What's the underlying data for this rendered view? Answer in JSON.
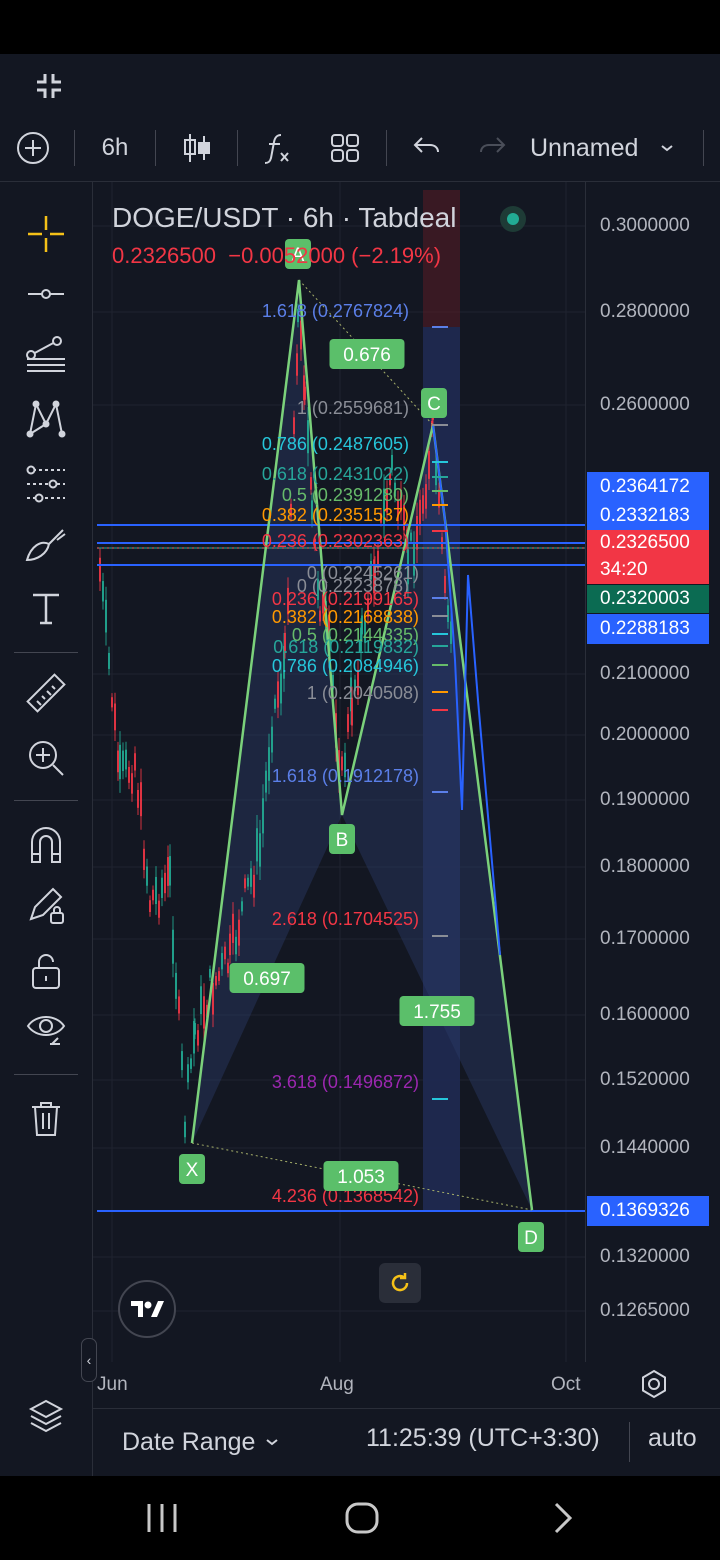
{
  "toolbar": {
    "interval": "6h",
    "layout_name": "Unnamed"
  },
  "legend": {
    "symbol": "DOGE/USDT · 6h · Tabdeal",
    "quote": "0.2326500  −0.0052000 (−2.19%)"
  },
  "price_axis": {
    "ticks": [
      "0.3000000",
      "0.2800000",
      "0.2600000",
      "0.2100000",
      "0.2000000",
      "0.1900000",
      "0.1800000",
      "0.1700000",
      "0.1600000",
      "0.1520000",
      "0.1440000",
      "0.1320000",
      "0.1265000"
    ],
    "badges": [
      {
        "text": "0.2364172",
        "color": "#2962ff"
      },
      {
        "text": "0.2332183",
        "color": "#2962ff"
      },
      {
        "text": "0.2326500",
        "color": "#f23645"
      },
      {
        "text": "34:20",
        "color": "#f23645"
      },
      {
        "text": "0.2320003",
        "color": "#0b6b52"
      },
      {
        "text": "0.2288183",
        "color": "#2962ff"
      },
      {
        "text": "0.1369326",
        "color": "#2962ff"
      }
    ]
  },
  "time_axis": {
    "labels": [
      "Jun",
      "Aug",
      "Oct"
    ]
  },
  "pattern": {
    "points": [
      "X",
      "A",
      "B",
      "C",
      "D"
    ],
    "ratios": [
      "0.676",
      "0.697",
      "1.755",
      "1.053"
    ]
  },
  "fib_upper": [
    {
      "text": "1.618 (0.2767824)",
      "color": "#5b7fe8"
    },
    {
      "text": "1 (0.2559681)",
      "color": "#8a8d96"
    },
    {
      "text": "0.786 (0.2487605)",
      "color": "#26c6da"
    },
    {
      "text": "0.618 (0.2431022)",
      "color": "#26a69a"
    },
    {
      "text": "0.5 (0.2391280)",
      "color": "#66bb6a"
    },
    {
      "text": "0.382 (0.2351537)",
      "color": "#ff9800"
    },
    {
      "text": "0.236 (0.2302363)",
      "color": "#f23645"
    },
    {
      "text": "0 (0.2223878)",
      "color": "#8a8d96"
    }
  ],
  "fib_lower": [
    {
      "text": "0 (0.2245261)",
      "color": "#8a8d96"
    },
    {
      "text": "0.236 (0.2199165)",
      "color": "#f23645"
    },
    {
      "text": "0.382 (0.2168838)",
      "color": "#ff9800"
    },
    {
      "text": "0.5 (0.2144335)",
      "color": "#66bb6a"
    },
    {
      "text": "0.618 (0.2119832)",
      "color": "#26a69a"
    },
    {
      "text": "0.786 (0.2084946)",
      "color": "#26c6da"
    },
    {
      "text": "1 (0.2040508)",
      "color": "#8a8d96"
    },
    {
      "text": "1.618 (0.1912178)",
      "color": "#5b7fe8"
    },
    {
      "text": "2.618 (0.1704525)",
      "color": "#f23645"
    },
    {
      "text": "3.618 (0.1496872)",
      "color": "#9c27b0"
    },
    {
      "text": "4.236 (0.1368542)",
      "color": "#f23645"
    }
  ],
  "bottom": {
    "date_range": "Date Range",
    "clock": "11:25:39 (UTC+3:30)",
    "scale": "auto"
  },
  "colors": {
    "bg": "#131722",
    "pattern_line": "#7bd17b",
    "pattern_fill": "#2b3a66",
    "accent": "#f5c118"
  }
}
